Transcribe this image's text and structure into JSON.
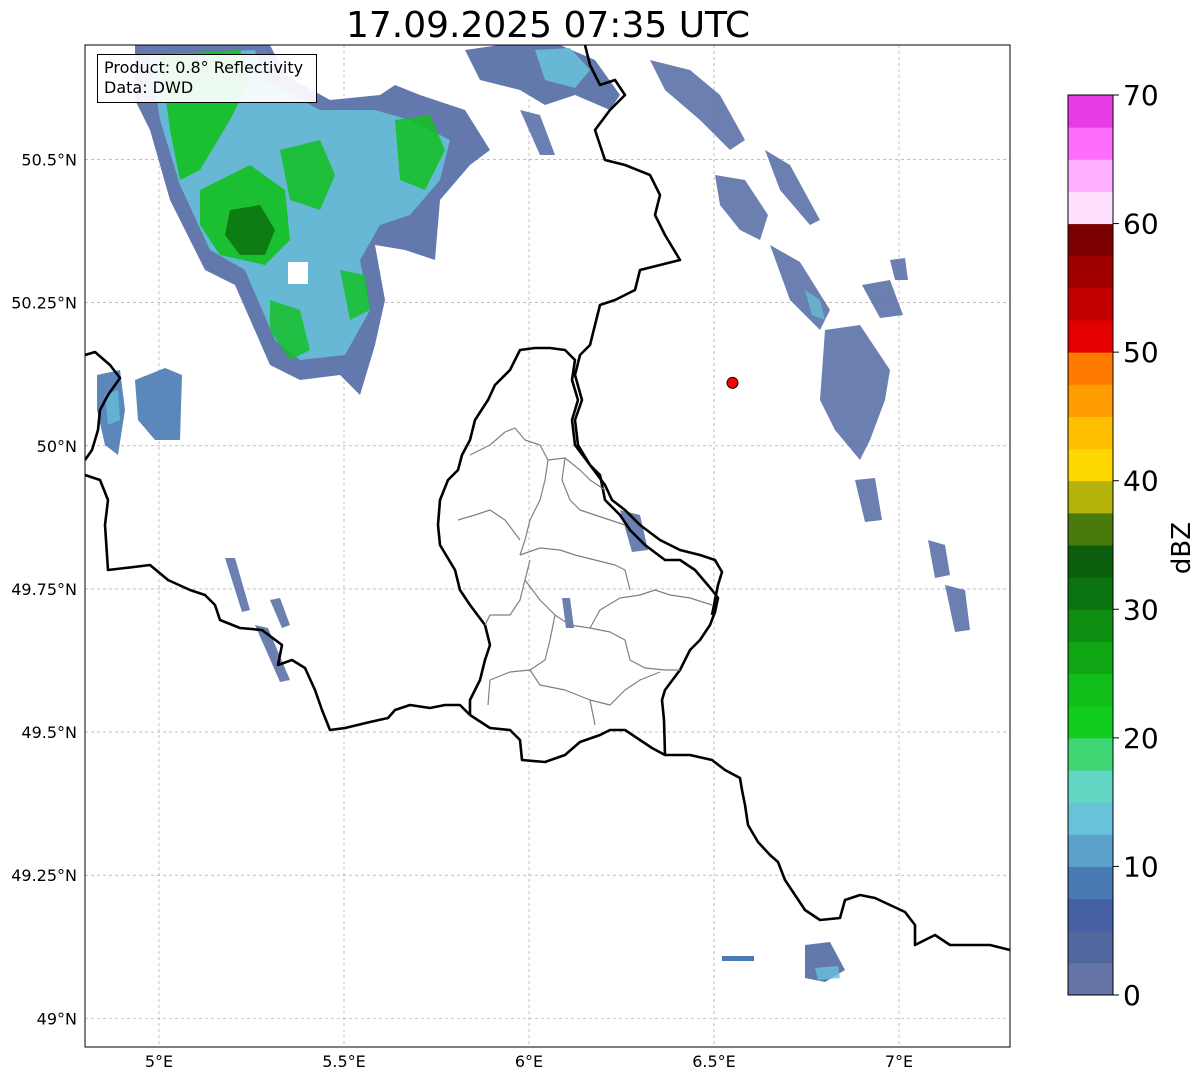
{
  "title": "17.09.2025 07:35 UTC",
  "info_box": {
    "product_line": "Product: 0.8° Reflectivity",
    "data_line": "Data: DWD"
  },
  "axes": {
    "lon_ticks": [
      {
        "value": 5.0,
        "label": "5°E"
      },
      {
        "value": 5.5,
        "label": "5.5°E"
      },
      {
        "value": 6.0,
        "label": "6°E"
      },
      {
        "value": 6.5,
        "label": "6.5°E"
      },
      {
        "value": 7.0,
        "label": "7°E"
      }
    ],
    "lat_ticks": [
      {
        "value": 50.5,
        "label": "50.5°N"
      },
      {
        "value": 50.25,
        "label": "50.25°N"
      },
      {
        "value": 50.0,
        "label": "50°N"
      },
      {
        "value": 49.75,
        "label": "49.75°N"
      },
      {
        "value": 49.5,
        "label": "49.5°N"
      },
      {
        "value": 49.25,
        "label": "49.25°N"
      },
      {
        "value": 49.0,
        "label": "49°N"
      }
    ],
    "lon_range": [
      4.8,
      7.3
    ],
    "lat_range": [
      48.95,
      50.7
    ],
    "grid": true
  },
  "marker": {
    "lon": 6.55,
    "lat": 50.11,
    "color": "#ff0000"
  },
  "colorbar": {
    "label": "dBZ",
    "min": 0,
    "max": 70,
    "ticks": [
      "0",
      "10",
      "20",
      "30",
      "40",
      "50",
      "60",
      "70"
    ],
    "colors": [
      "#6675a8",
      "#51689f",
      "#4560a5",
      "#4a7ab3",
      "#5ba1c9",
      "#66c3da",
      "#63d6c3",
      "#3dd672",
      "#12cc1e",
      "#12be1a",
      "#11a614",
      "#0f8f12",
      "#0b7410",
      "#0a5e0c",
      "#4a7b0a",
      "#b3b30a",
      "#ffd700",
      "#ffbe00",
      "#ff9c00",
      "#ff7b00",
      "#e50000",
      "#c20000",
      "#a00000",
      "#7d0000",
      "#ffe0ff",
      "#ffb1ff",
      "#ff6dff",
      "#e83be8"
    ]
  },
  "reflectivity_colors": {
    "weak": "#5b72a9",
    "light": "#4a7ab3",
    "cyan": "#66c3da",
    "green": "#12c120",
    "dark_green": "#0b7410"
  }
}
